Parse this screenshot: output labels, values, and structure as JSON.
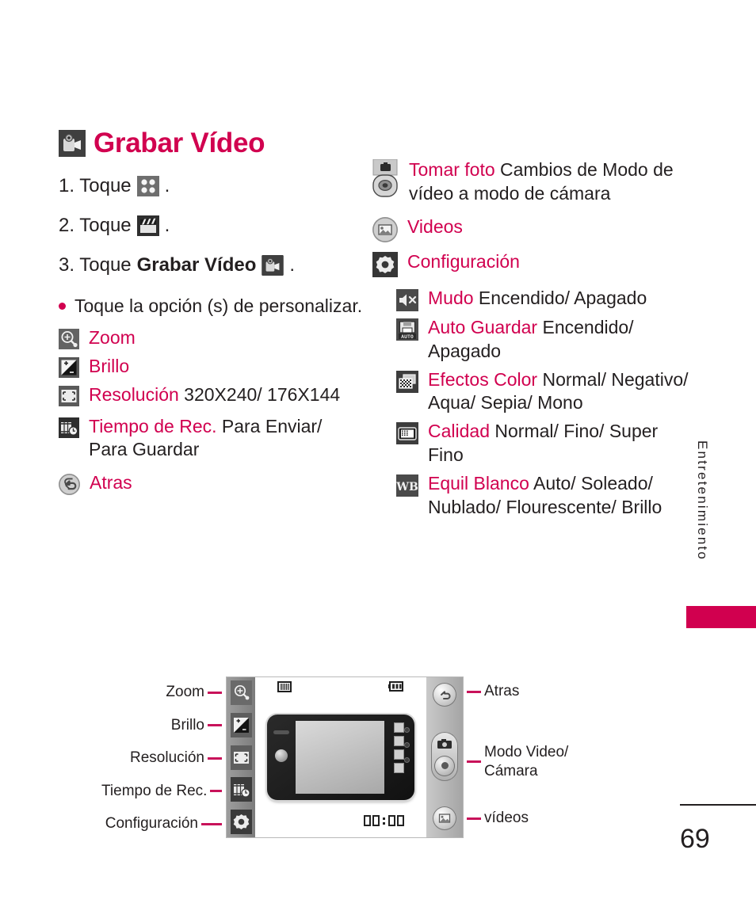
{
  "header": {
    "title": "Grabar Vídeo",
    "icon": "camcorder-icon"
  },
  "steps": [
    {
      "num": "1. Toque",
      "icon": "grid-four-dots-icon",
      "after": "."
    },
    {
      "num": "2. Toque",
      "icon": "clapperboard-icon",
      "after": "."
    },
    {
      "num": "3. Toque",
      "bold": "Grabar Vídeo",
      "icon": "camcorder-icon",
      "after": "."
    }
  ],
  "bullet": {
    "text": "Toque la opción (s) de personalizar."
  },
  "left_options": [
    {
      "icon": "zoom-magnifier-icon",
      "label": "Zoom",
      "value": ""
    },
    {
      "icon": "brightness-icon",
      "label": "Brillo",
      "value": ""
    },
    {
      "icon": "resolution-icon",
      "label": "Resolución",
      "value": " 320X240/ 176X144"
    },
    {
      "icon": "rec-time-icon",
      "label": "Tiempo de Rec.",
      "value": " Para Enviar/ Para Guardar"
    },
    {
      "icon": "back-arrow-icon",
      "label": "Atras",
      "value": ""
    }
  ],
  "right_options": [
    {
      "icon": "camera-mode-icon",
      "label": "Tomar foto",
      "value": " Cambios de Modo de vídeo a modo de cámara"
    },
    {
      "icon": "gallery-icon",
      "label": "Videos",
      "value": ""
    },
    {
      "icon": "gear-icon",
      "label": "Configuración",
      "value": ""
    }
  ],
  "settings_options": [
    {
      "icon": "mute-speaker-icon",
      "label": "Mudo",
      "value": " Encendido/ Apagado"
    },
    {
      "icon": "auto-save-icon",
      "label": "Auto Guardar",
      "value": " Encendido/ Apagado"
    },
    {
      "icon": "color-effects-icon",
      "label": "Efectos Color",
      "value": " Normal/ Negativo/ Aqua/ Sepia/ Mono"
    },
    {
      "icon": "quality-icon",
      "label": "Calidad",
      "value": " Normal/ Fino/ Super Fino"
    },
    {
      "icon": "white-balance-icon",
      "label": "Equil Blanco",
      "value": " Auto/ Soleado/ Nublado/ Flourescente/ Brillo"
    }
  ],
  "diagram": {
    "left_labels": [
      "Zoom",
      "Brillo",
      "Resolución",
      "Tiempo de Rec.",
      "Configuración"
    ],
    "right_labels": [
      "Atras",
      "Modo Video/ Cámara",
      "vídeos"
    ],
    "right_label_line1": "Modo Video/",
    "right_label_line2": "Cámara",
    "timer": "00:00"
  },
  "sidebar": {
    "vertical_tab": "Entretenimiento",
    "accent_color": "#d1004f"
  },
  "footer": {
    "page_number": "69"
  }
}
